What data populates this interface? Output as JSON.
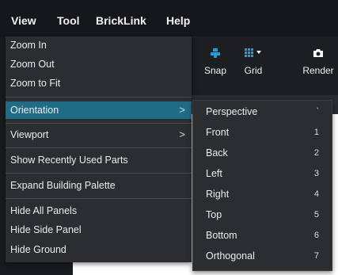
{
  "menubar": {
    "items": [
      {
        "label": "View"
      },
      {
        "label": "Tool"
      },
      {
        "label": "BrickLink"
      },
      {
        "label": "Help"
      }
    ]
  },
  "toolbar": {
    "snap_label": "Snap",
    "grid_label": "Grid",
    "render_label": "Render",
    "icons": {
      "snap": "snap-magnet-icon",
      "grid": "grid-icon",
      "grid_dropdown": "caret-down-icon",
      "render": "camera-icon"
    },
    "accent_color": "#1f9fd8"
  },
  "view_menu": {
    "items": [
      {
        "label": "Zoom In"
      },
      {
        "label": "Zoom Out"
      },
      {
        "label": "Zoom to Fit"
      },
      {
        "label": "Orientation",
        "has_submenu": true,
        "active": true
      },
      {
        "label": "Viewport",
        "has_submenu": true
      },
      {
        "label": "Show Recently Used Parts"
      },
      {
        "label": "Expand Building Palette"
      },
      {
        "label": "Hide All Panels"
      },
      {
        "label": "Hide Side Panel"
      },
      {
        "label": "Hide Ground"
      }
    ],
    "submenu_arrow": ">",
    "highlight_color": "#1f6c86"
  },
  "orientation_submenu": {
    "items": [
      {
        "label": "Perspective",
        "shortcut": "`"
      },
      {
        "label": "Front",
        "shortcut": "1"
      },
      {
        "label": "Back",
        "shortcut": "2"
      },
      {
        "label": "Left",
        "shortcut": "3"
      },
      {
        "label": "Right",
        "shortcut": "4"
      },
      {
        "label": "Top",
        "shortcut": "5"
      },
      {
        "label": "Bottom",
        "shortcut": "6"
      },
      {
        "label": "Orthogonal",
        "shortcut": "7"
      }
    ]
  }
}
